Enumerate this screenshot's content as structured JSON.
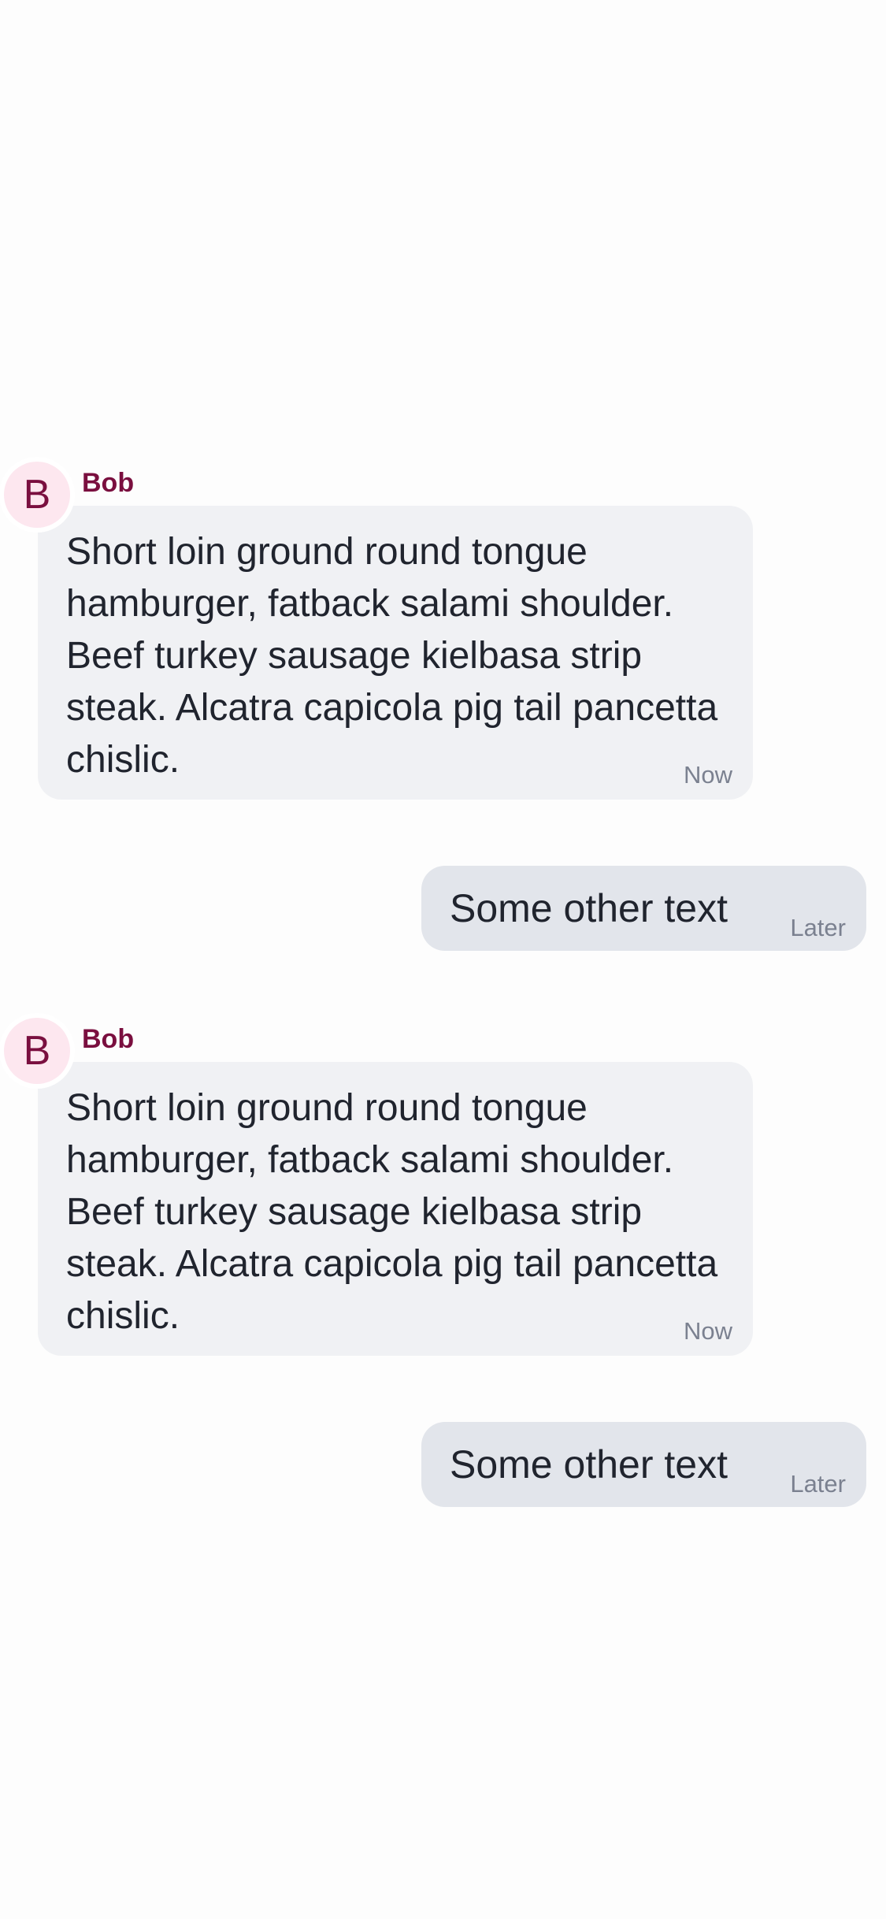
{
  "messages": [
    {
      "direction": "incoming",
      "sender": "Bob",
      "avatar_initial": "B",
      "text": "Short loin ground round tongue hamburger, fatback salami shoulder. Beef turkey sausage kielbasa strip steak. Alcatra capicola pig tail pancetta chislic.",
      "time": "Now"
    },
    {
      "direction": "outgoing",
      "text": "Some other text",
      "time": "Later"
    },
    {
      "direction": "incoming",
      "sender": "Bob",
      "avatar_initial": "B",
      "text": "Short loin ground round tongue hamburger, fatback salami shoulder. Beef turkey sausage kielbasa strip steak. Alcatra capicola pig tail pancetta chislic.",
      "time": "Now"
    },
    {
      "direction": "outgoing",
      "text": "Some other text",
      "time": "Later"
    }
  ],
  "colors": {
    "background": "#fdfdfd",
    "incoming_bubble": "#f0f1f4",
    "outgoing_bubble": "#e2e5eb",
    "avatar_bg": "#fde7ef",
    "sender_name": "#7a0f3f",
    "timestamp": "#7b8190",
    "message_text": "#20242e"
  }
}
